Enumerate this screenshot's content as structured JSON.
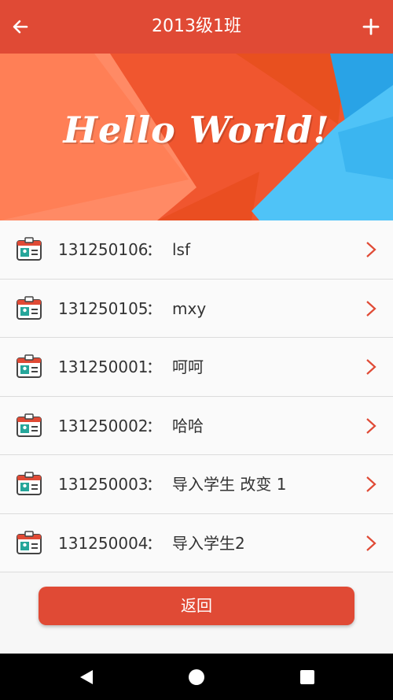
{
  "appbar": {
    "title": "2013级1班",
    "back_icon": "arrow-back-icon",
    "add_icon": "plus-icon"
  },
  "banner": {
    "text": "Hello World!"
  },
  "students": [
    {
      "id": "131250106",
      "sep": "：",
      "name": "lsf"
    },
    {
      "id": "131250105",
      "sep": "：",
      "name": "mxy"
    },
    {
      "id": "131250001",
      "sep": "：",
      "name": "呵呵"
    },
    {
      "id": "131250002",
      "sep": "：",
      "name": "哈哈"
    },
    {
      "id": "131250003",
      "sep": "：",
      "name": "导入学生 改变 1"
    },
    {
      "id": "131250004",
      "sep": "：",
      "name": "导入学生2"
    }
  ],
  "return_button": {
    "label": "返回"
  },
  "colors": {
    "primary": "#e04a35",
    "banner_orange": "#f0562f",
    "banner_blue": "#4fc3f7"
  },
  "navbar": {
    "back": "triangle-back-icon",
    "home": "circle-home-icon",
    "recents": "square-recents-icon"
  }
}
